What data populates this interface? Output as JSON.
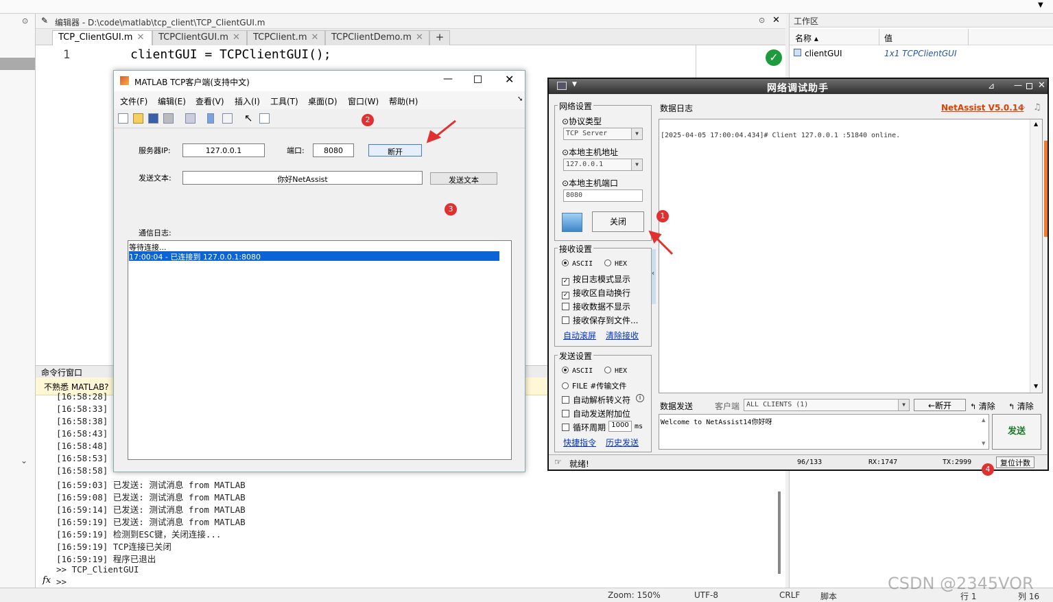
{
  "editor": {
    "header": "编辑器 - D:\\code\\matlab\\tcp_client\\TCP_ClientGUI.m",
    "tabs": [
      {
        "label": "TCP_ClientGUI.m"
      },
      {
        "label": "TCPClientGUI.m"
      },
      {
        "label": "TCPClient.m"
      },
      {
        "label": "TCPClientDemo.m"
      }
    ],
    "add_tab": "+",
    "line_number": "1",
    "code": "clientGUI = TCPClientGUI();"
  },
  "cmd": {
    "title": "命令行窗口",
    "notice": "不熟悉 MATLAB?",
    "lines": [
      "[16:58:28]",
      "[16:58:33]",
      "[16:58:38]",
      "[16:58:43]",
      "[16:58:48]",
      "[16:58:53]",
      "[16:58:58]",
      "[16:59:03] 已发送: 测试消息 from MATLAB",
      "[16:59:08] 已发送: 测试消息 from MATLAB",
      "[16:59:14] 已发送: 测试消息 from MATLAB",
      "[16:59:19] 已发送: 测试消息 from MATLAB",
      "[16:59:19] 检测到ESC键，关闭连接...",
      "[16:59:19] TCP连接已关闭",
      "[16:59:19] 程序已退出",
      ">> TCP_ClientGUI",
      ">>"
    ],
    "fx": "fx"
  },
  "workspace": {
    "title": "工作区",
    "col_name": "名称 ▴",
    "col_value": "值",
    "var_name": "clientGUI",
    "var_value": "1x1 TCPClientGUI"
  },
  "status": {
    "zoom": "Zoom: 150%",
    "encoding": "UTF-8",
    "eol": "CRLF",
    "type": "脚本",
    "row": "行 1",
    "col": "列 16"
  },
  "gui": {
    "title": "MATLAB TCP客户端(支持中文)",
    "menus": [
      "文件(F)",
      "编辑(E)",
      "查看(V)",
      "插入(I)",
      "工具(T)",
      "桌面(D)",
      "窗口(W)",
      "帮助(H)"
    ],
    "server_ip_label": "服务器IP:",
    "server_ip": "127.0.0.1",
    "port_label": "端口:",
    "port": "8080",
    "disconnect": "断开",
    "send_label": "发送文本:",
    "send_text": "你好NetAssist",
    "send_button": "发送文本",
    "log_label": "通信日志:",
    "log_lines": [
      "等待连接...",
      "17:00:04 - 已连接到 127.0.0.1:8080"
    ]
  },
  "na": {
    "title": "网络调试助手",
    "version": "NetAssist V5.0.14",
    "net_settings": "网络设置",
    "protocol_label": "⊙协议类型",
    "protocol": "TCP Server",
    "local_addr_label": "⊙本地主机地址",
    "local_addr": "127.0.0.1",
    "local_port_label": "⊙本地主机端口",
    "local_port": "8080",
    "close_button": "关闭",
    "recv_settings": "接收设置",
    "ascii": "ASCII",
    "hex": "HEX",
    "recv_opts": [
      "按日志模式显示",
      "接收区自动换行",
      "接收数据不显示",
      "接收保存到文件..."
    ],
    "auto_scroll": "自动滚屏",
    "clear_recv": "清除接收",
    "send_settings": "发送设置",
    "file_opt": "FILE #传输文件",
    "send_opts": [
      "自动解析转义符",
      "自动发送附加位"
    ],
    "cycle_label": "循环周期",
    "cycle_value": "1000",
    "cycle_unit": "ms",
    "shortcut": "快捷指令",
    "history": "历史发送",
    "data_log_tab": "数据日志",
    "log_line": "[2025-04-05 17:00:04.434]# Client 127.0.0.1 :51840 online.",
    "data_send_tab": "数据发送",
    "client_label": "客户端",
    "client_select": "ALL CLIENTS (1)",
    "disconnect": "←断开",
    "clear1": "清除",
    "clear2": "清除",
    "send_content": "Welcome to NetAssist14你好呀",
    "send_button": "发送",
    "ready": "就绪!",
    "count": "96/133",
    "rx": "RX:1747",
    "tx": "TX:2999",
    "reset": "复位计数"
  },
  "markers": [
    "1",
    "2",
    "3",
    "4"
  ],
  "watermark": "CSDN @2345VOR"
}
